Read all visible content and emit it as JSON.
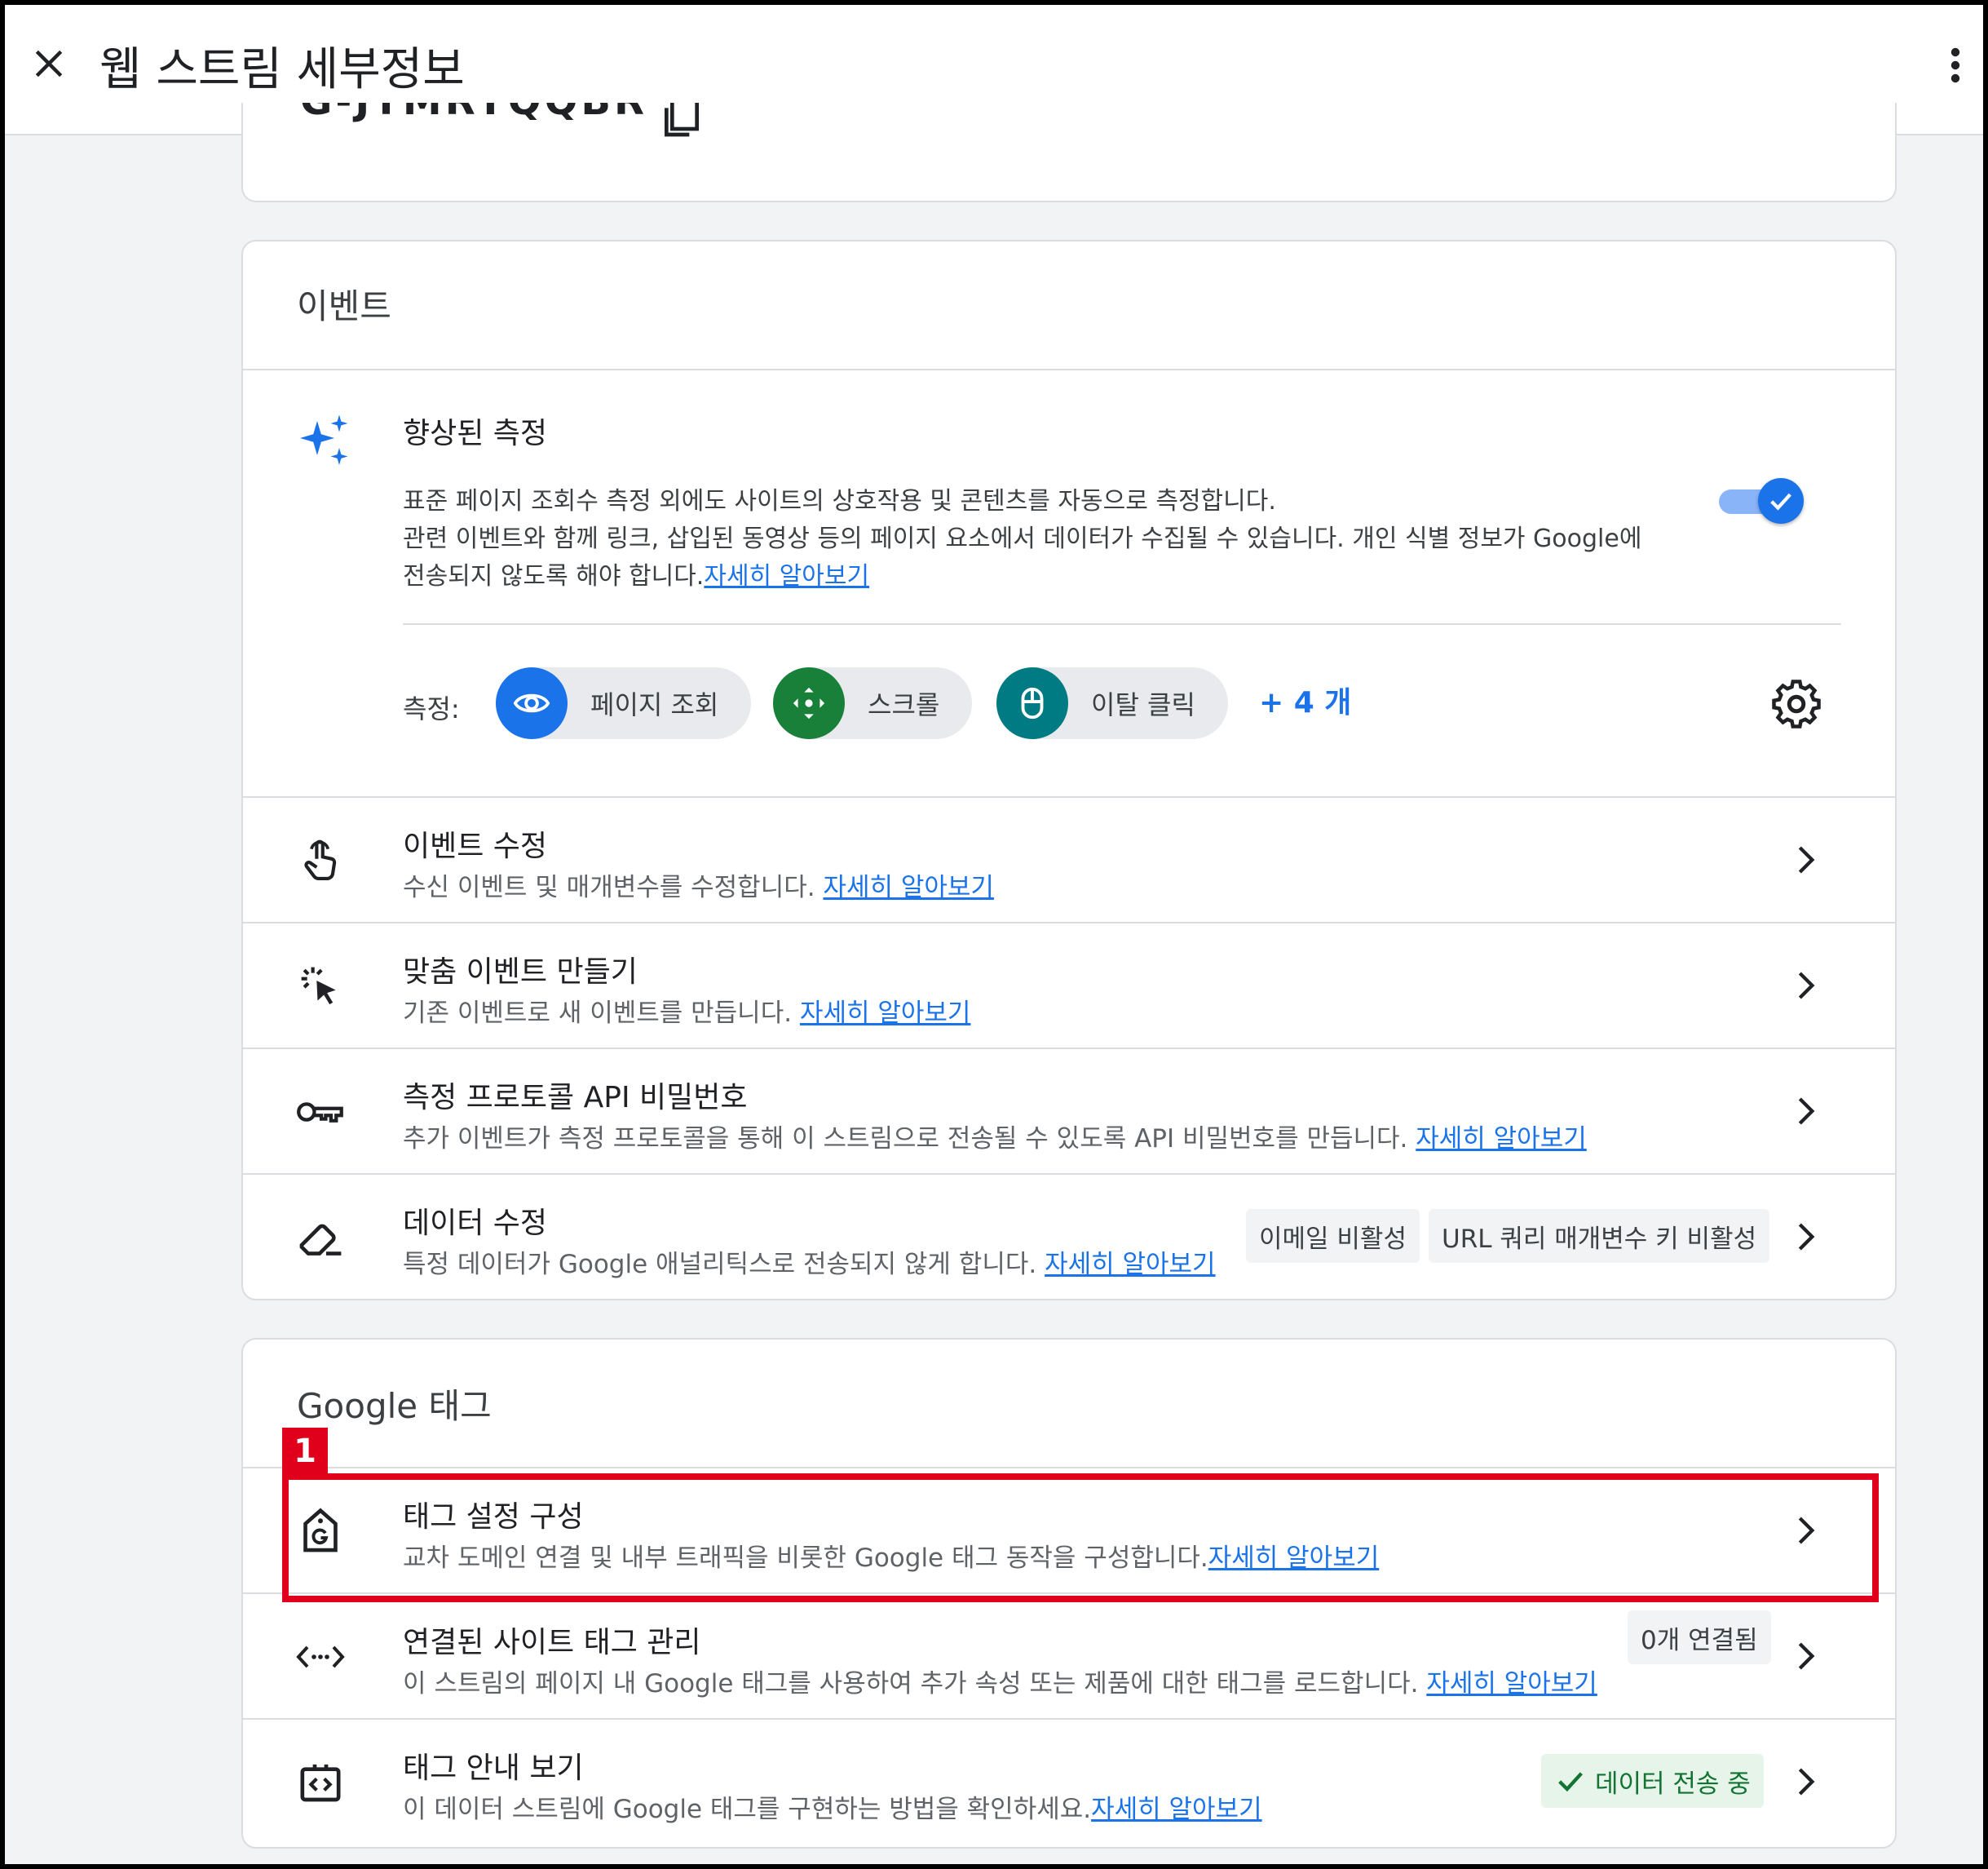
{
  "header": {
    "title": "웹 스트림 세부정보"
  },
  "top_card": {
    "stream_id_partial": "G-JTMRYQQBR"
  },
  "events": {
    "section_title": "이벤트",
    "enhanced": {
      "title": "향상된 측정",
      "desc_line1": "표준 페이지 조회수 측정 외에도 사이트의 상호작용 및 콘텐츠를 자동으로 측정합니다.",
      "desc_line2": "관련 이벤트와 함께 링크, 삽입된 동영상 등의 페이지 요소에서 데이터가 수집될 수 있습니다. 개인 식별 정보가 Google에",
      "desc_line3": "전송되지 않도록 해야 합니다.",
      "link": "자세히 알아보기",
      "toggle_on": true,
      "measure_label": "측정:",
      "chips": [
        {
          "label": "페이지 조회",
          "icon": "eye-icon",
          "color": "#1a73e8"
        },
        {
          "label": "스크롤",
          "icon": "scroll-arrows-icon",
          "color": "#188038"
        },
        {
          "label": "이탈 클릭",
          "icon": "mouse-icon",
          "color": "#007b83"
        }
      ],
      "more": "+ 4 개"
    },
    "rows": [
      {
        "title": "이벤트 수정",
        "desc": "수신 이벤트 및 매개변수를 수정합니다. ",
        "link": "자세히 알아보기",
        "icon": "touch-hand-icon"
      },
      {
        "title": "맞춤 이벤트 만들기",
        "desc": "기존 이벤트로 새 이벤트를 만듭니다. ",
        "link": "자세히 알아보기",
        "icon": "click-sparkle-icon"
      },
      {
        "title": "측정 프로토콜 API 비밀번호",
        "desc": "추가 이벤트가 측정 프로토콜을 통해 이 스트림으로 전송될 수 있도록 API 비밀번호를 만듭니다. ",
        "link": "자세히 알아보기",
        "icon": "key-icon"
      },
      {
        "title": "데이터 수정",
        "desc": "특정 데이터가 Google 애널리틱스로 전송되지 않게 합니다. ",
        "link": "자세히 알아보기",
        "icon": "eraser-icon",
        "badges": [
          "이메일 비활성",
          "URL 쿼리 매개변수 키 비활성"
        ]
      }
    ]
  },
  "google_tag": {
    "section_title": "Google 태그",
    "rows": [
      {
        "title": "태그 설정 구성",
        "desc": "교차 도메인 연결 및 내부 트래픽을 비롯한 Google 태그 동작을 구성합니다.",
        "link": "자세히 알아보기",
        "icon": "google-tag-icon"
      },
      {
        "title": "연결된 사이트 태그 관리",
        "desc": "이 스트림의 페이지 내 Google 태그를 사용하여 추가 속성 또는 제품에 대한 태그를 로드합니다. ",
        "link": "자세히 알아보기",
        "icon": "code-arrows-icon",
        "badge": "0개 연결됨"
      },
      {
        "title": "태그 안내 보기",
        "desc": "이 데이터 스트림에 Google 태그를 구현하는 방법을 확인하세요.",
        "link": "자세히 알아보기",
        "icon": "code-tag-icon",
        "status": "데이터 전송 중"
      }
    ]
  },
  "annotation": {
    "number": "1",
    "color": "#e0001b"
  }
}
